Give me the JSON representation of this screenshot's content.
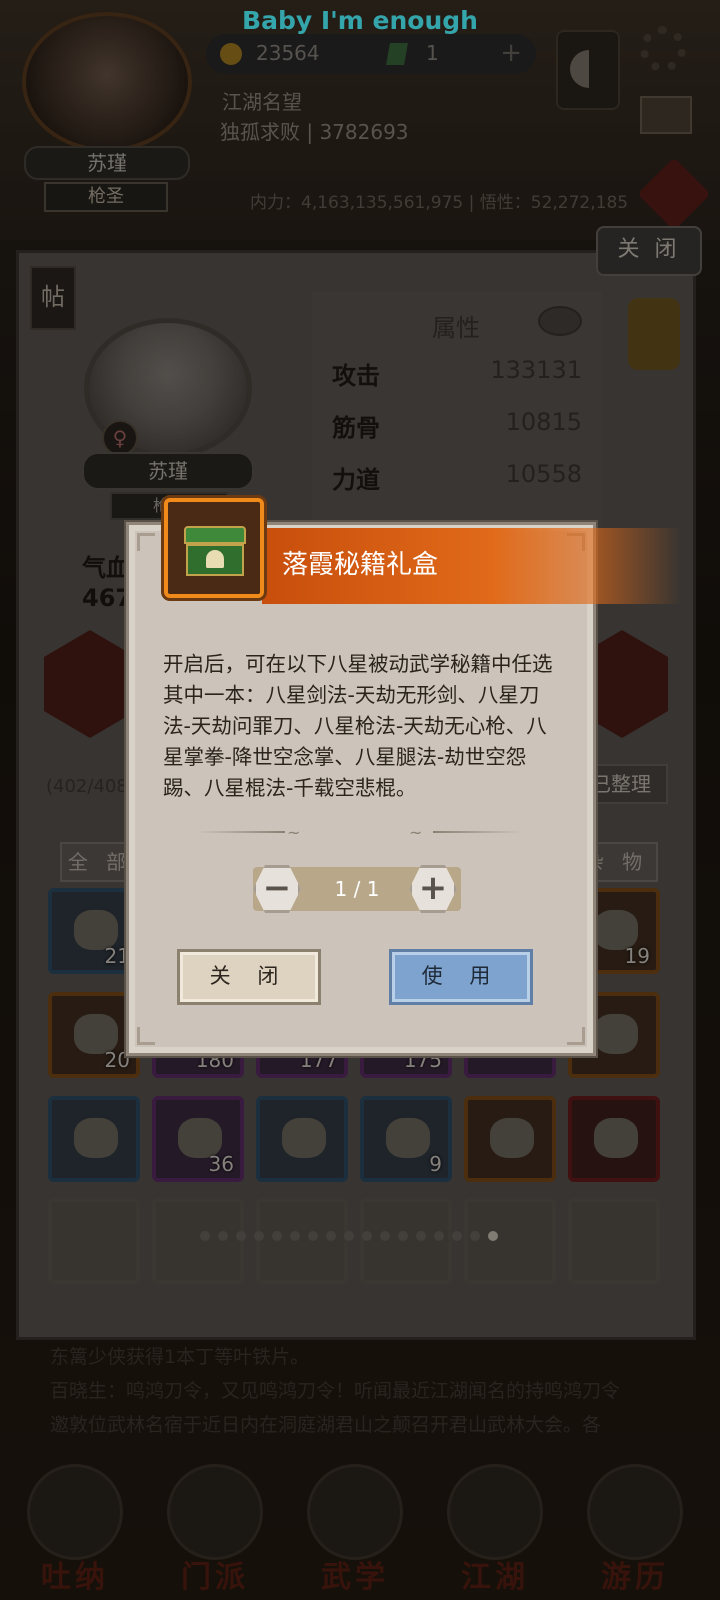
{
  "status_bar": {
    "media_text": "Baby I'm enough"
  },
  "header": {
    "player_name": "苏瑾",
    "player_title": "枪圣",
    "gold": "23564",
    "gems": "1",
    "fame_label": "江湖名望",
    "fame_value": "独孤求败 | 3782693",
    "power_line": "内力：4,163,135,561,975 | 悟性：52,272,185"
  },
  "panel": {
    "close_label": "关 闭",
    "post_tag": "帖",
    "character": {
      "name": "苏瑾",
      "rank": "枪圣",
      "gender_icon": "female-icon"
    },
    "attributes_title": "属性",
    "attributes": [
      {
        "name": "攻击",
        "value": "133131"
      },
      {
        "name": "筋骨",
        "value": "10815"
      },
      {
        "name": "力道",
        "value": "10558"
      }
    ],
    "hp_label": "气血",
    "hp_value": "467",
    "capacity": "(402/408",
    "organized_label": "已整理",
    "tab_all": "全 部",
    "tab_misc": "杂 物",
    "rows": [
      [
        {
          "rarity": "blue",
          "count": "21"
        },
        null,
        null,
        null,
        null,
        {
          "rarity": "orange",
          "count": "19"
        }
      ],
      [
        {
          "rarity": "orange",
          "count": "20"
        },
        {
          "rarity": "purple",
          "count": "180"
        },
        {
          "rarity": "purple",
          "count": "177"
        },
        {
          "rarity": "purple",
          "count": "175"
        },
        {
          "rarity": "purple",
          "count": ""
        },
        {
          "rarity": "orange",
          "count": ""
        }
      ],
      [
        {
          "rarity": "blue",
          "count": ""
        },
        {
          "rarity": "purple",
          "count": "36"
        },
        {
          "rarity": "blue",
          "count": ""
        },
        {
          "rarity": "blue",
          "count": "9"
        },
        {
          "rarity": "orange",
          "count": ""
        },
        {
          "rarity": "red",
          "count": ""
        }
      ]
    ]
  },
  "news": {
    "lines": [
      "东篱少侠获得1本丁等叶铁片。",
      "百晓生：鸣鸿刀令，又见鸣鸿刀令！听闻最近江湖闻名的持鸣鸿刀令",
      "邀敦位武林名宿于近日内在洞庭湖君山之颠召开君山武林大会。各"
    ]
  },
  "bottom_nav": [
    "吐纳",
    "门派",
    "武学",
    "江湖",
    "游历"
  ],
  "modal": {
    "title": "落霞秘籍礼盒",
    "item_icon": "green-treasure-chest-icon",
    "description": "开启后，可在以下八星被动武学秘籍中任选其中一本：八星剑法-天劫无形剑、八星刀法-天劫问罪刀、八星枪法-天劫无心枪、八星掌拳-降世空念掌、八星腿法-劫世空怨踢、八星棍法-千载空悲棍。",
    "quantity": "1 / 1",
    "minus_symbol": "一",
    "plus_symbol": "十",
    "close_label": "关 闭",
    "use_label": "使 用",
    "colors": {
      "title_banner": "#d85f14",
      "use_button": "#7ea3cf",
      "close_button": "#ddd3c0",
      "icon_frame": "#f08a1a"
    }
  }
}
